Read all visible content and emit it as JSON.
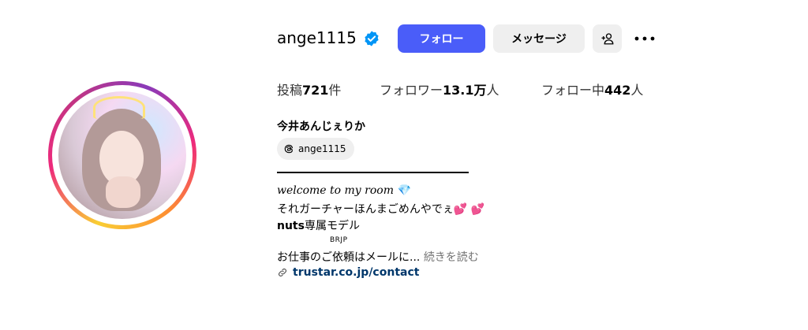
{
  "profile": {
    "username": "ange1115",
    "follow_label": "フォロー",
    "message_label": "メッセージ",
    "stats": {
      "posts_label": "投稿",
      "posts_value": "721",
      "posts_unit": "件",
      "followers_label": "フォロワー",
      "followers_value": "13.1万",
      "followers_unit": "人",
      "following_label": "フォロー中",
      "following_value": "442",
      "following_unit": "人"
    },
    "full_name": "今井あんじぇりか",
    "threads_handle": "ange1115",
    "bio": {
      "line1": "welcome to my room",
      "line1_emoji": "💎",
      "line2": "それガーチャーほんまごめんやでぇ",
      "line2_emoji": "💕 💕",
      "line3_bold": "nuts",
      "line3_rest": "専属モデル",
      "small_tag": "BRJP",
      "line4": "お仕事のご依頼はメールに...",
      "more_label": "続きを読む"
    },
    "link": "trustar.co.jp/contact"
  },
  "colors": {
    "follow_button": "#4a5df9",
    "secondary_button": "#efefef",
    "verified": "#0095f6",
    "link": "#00376b"
  },
  "icons": [
    "verified-badge-icon",
    "add-person-icon",
    "more-options-icon",
    "threads-icon",
    "link-icon"
  ]
}
